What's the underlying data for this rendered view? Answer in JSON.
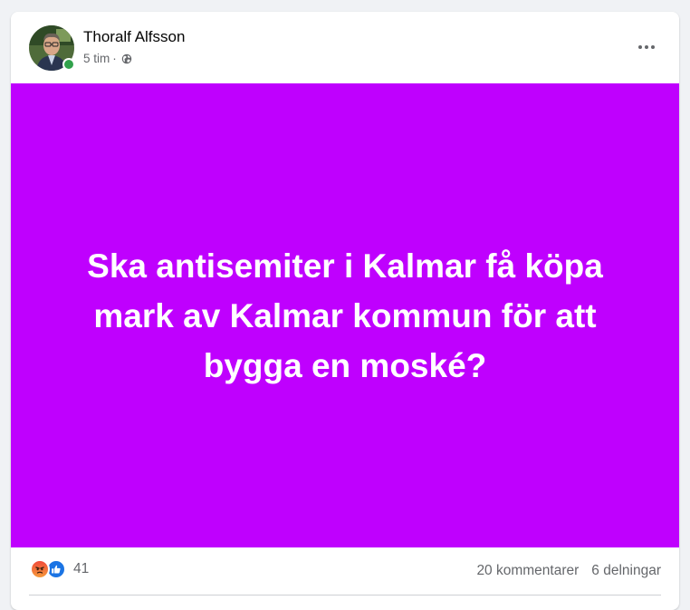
{
  "post": {
    "author": "Thoralf Alfsson",
    "timestamp": "5 tim",
    "separator": "·",
    "privacy_icon": "globe-icon",
    "more_icon": "more-horizontal-icon",
    "image_background": "#bf00fe",
    "image_text": "Ska antisemiter i Kalmar få köpa mark av Kalmar kommun för att bygga en moské?",
    "online": true
  },
  "footer": {
    "reaction_icons": [
      "angry-icon",
      "like-icon"
    ],
    "reaction_count": "41",
    "comments": "20 kommentarer",
    "shares": "6 delningar"
  },
  "colors": {
    "accent": "#1b74e4",
    "online": "#31a24c",
    "secondary_text": "#65676b"
  }
}
